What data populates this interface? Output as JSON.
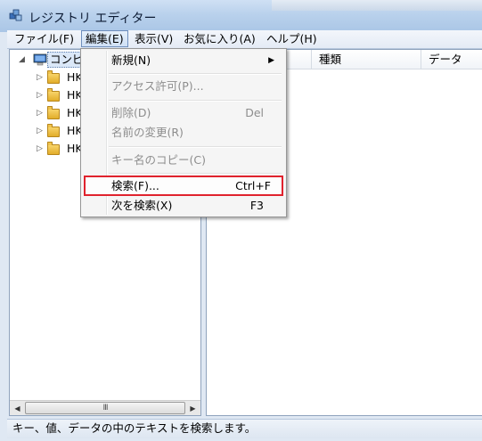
{
  "window": {
    "title": "レジストリ エディター"
  },
  "menubar": {
    "items": [
      "ファイル(F)",
      "編集(E)",
      "表示(V)",
      "お気に入り(A)",
      "ヘルプ(H)"
    ],
    "active_index": 1
  },
  "tree": {
    "root_label": "コンピ",
    "children": [
      "HK",
      "HK",
      "HK",
      "HK",
      "HK"
    ]
  },
  "hscroll": {
    "thumb_grip": "III",
    "left_arrow": "◀",
    "right_arrow": "▶"
  },
  "list": {
    "columns": [
      "",
      "種類",
      "データ"
    ]
  },
  "edit_menu": {
    "items": [
      {
        "label": "新規(N)",
        "shortcut": "",
        "submenu": true,
        "disabled": false
      },
      {
        "label": "アクセス許可(P)...",
        "shortcut": "",
        "submenu": false,
        "disabled": true
      },
      {
        "label": "削除(D)",
        "shortcut": "Del",
        "submenu": false,
        "disabled": true
      },
      {
        "label": "名前の変更(R)",
        "shortcut": "",
        "submenu": false,
        "disabled": true
      },
      {
        "label": "キー名のコピー(C)",
        "shortcut": "",
        "submenu": false,
        "disabled": true
      },
      {
        "label": "検索(F)...",
        "shortcut": "Ctrl+F",
        "submenu": false,
        "disabled": false,
        "highlighted": true
      },
      {
        "label": "次を検索(X)",
        "shortcut": "F3",
        "submenu": false,
        "disabled": false
      }
    ],
    "submenu_arrow": "▶",
    "highlight_color": "#e0222d"
  },
  "status": {
    "text": "キー、値、データの中のテキストを検索します。"
  }
}
